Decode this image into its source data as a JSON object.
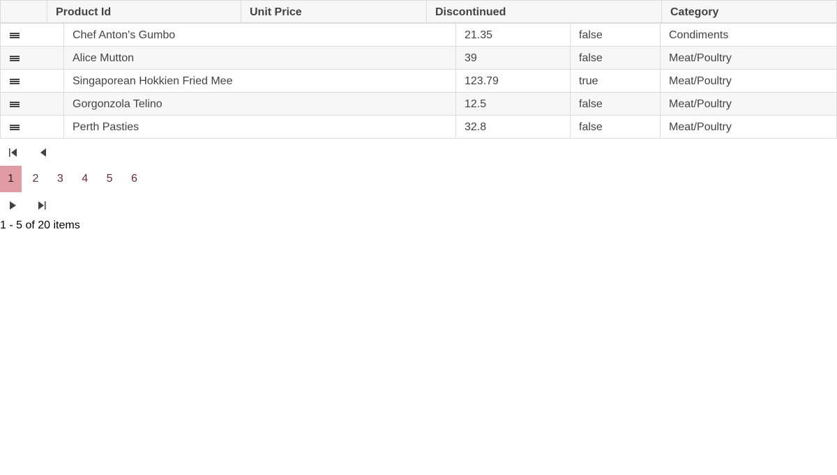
{
  "grid": {
    "columns": [
      "Product Id",
      "Unit Price",
      "Discontinued",
      "Category"
    ],
    "rows": [
      {
        "name": "Chef Anton's Gumbo",
        "price": "21.35",
        "discontinued": "false",
        "category": "Condiments"
      },
      {
        "name": "Alice Mutton",
        "price": "39",
        "discontinued": "false",
        "category": "Meat/Poultry"
      },
      {
        "name": "Singaporean Hokkien Fried Mee",
        "price": "123.79",
        "discontinued": "true",
        "category": "Meat/Poultry"
      },
      {
        "name": "Gorgonzola Telino",
        "price": "12.5",
        "discontinued": "false",
        "category": "Meat/Poultry"
      },
      {
        "name": "Perth Pasties",
        "price": "32.8",
        "discontinued": "false",
        "category": "Meat/Poultry"
      }
    ]
  },
  "pager": {
    "pages": [
      "1",
      "2",
      "3",
      "4",
      "5",
      "6"
    ],
    "selected_page": "1",
    "info": "1 - 5 of 20 items"
  },
  "icons": {
    "drag_handle": "drag-handle-icon",
    "first": "first-page-icon",
    "prev": "previous-page-icon",
    "next": "next-page-icon",
    "last": "last-page-icon"
  },
  "colors": {
    "selected_page_bg": "#e09ba5",
    "page_link": "#6b2a3a",
    "border": "#dcdcdc",
    "alt_row": "#f7f7f7"
  }
}
